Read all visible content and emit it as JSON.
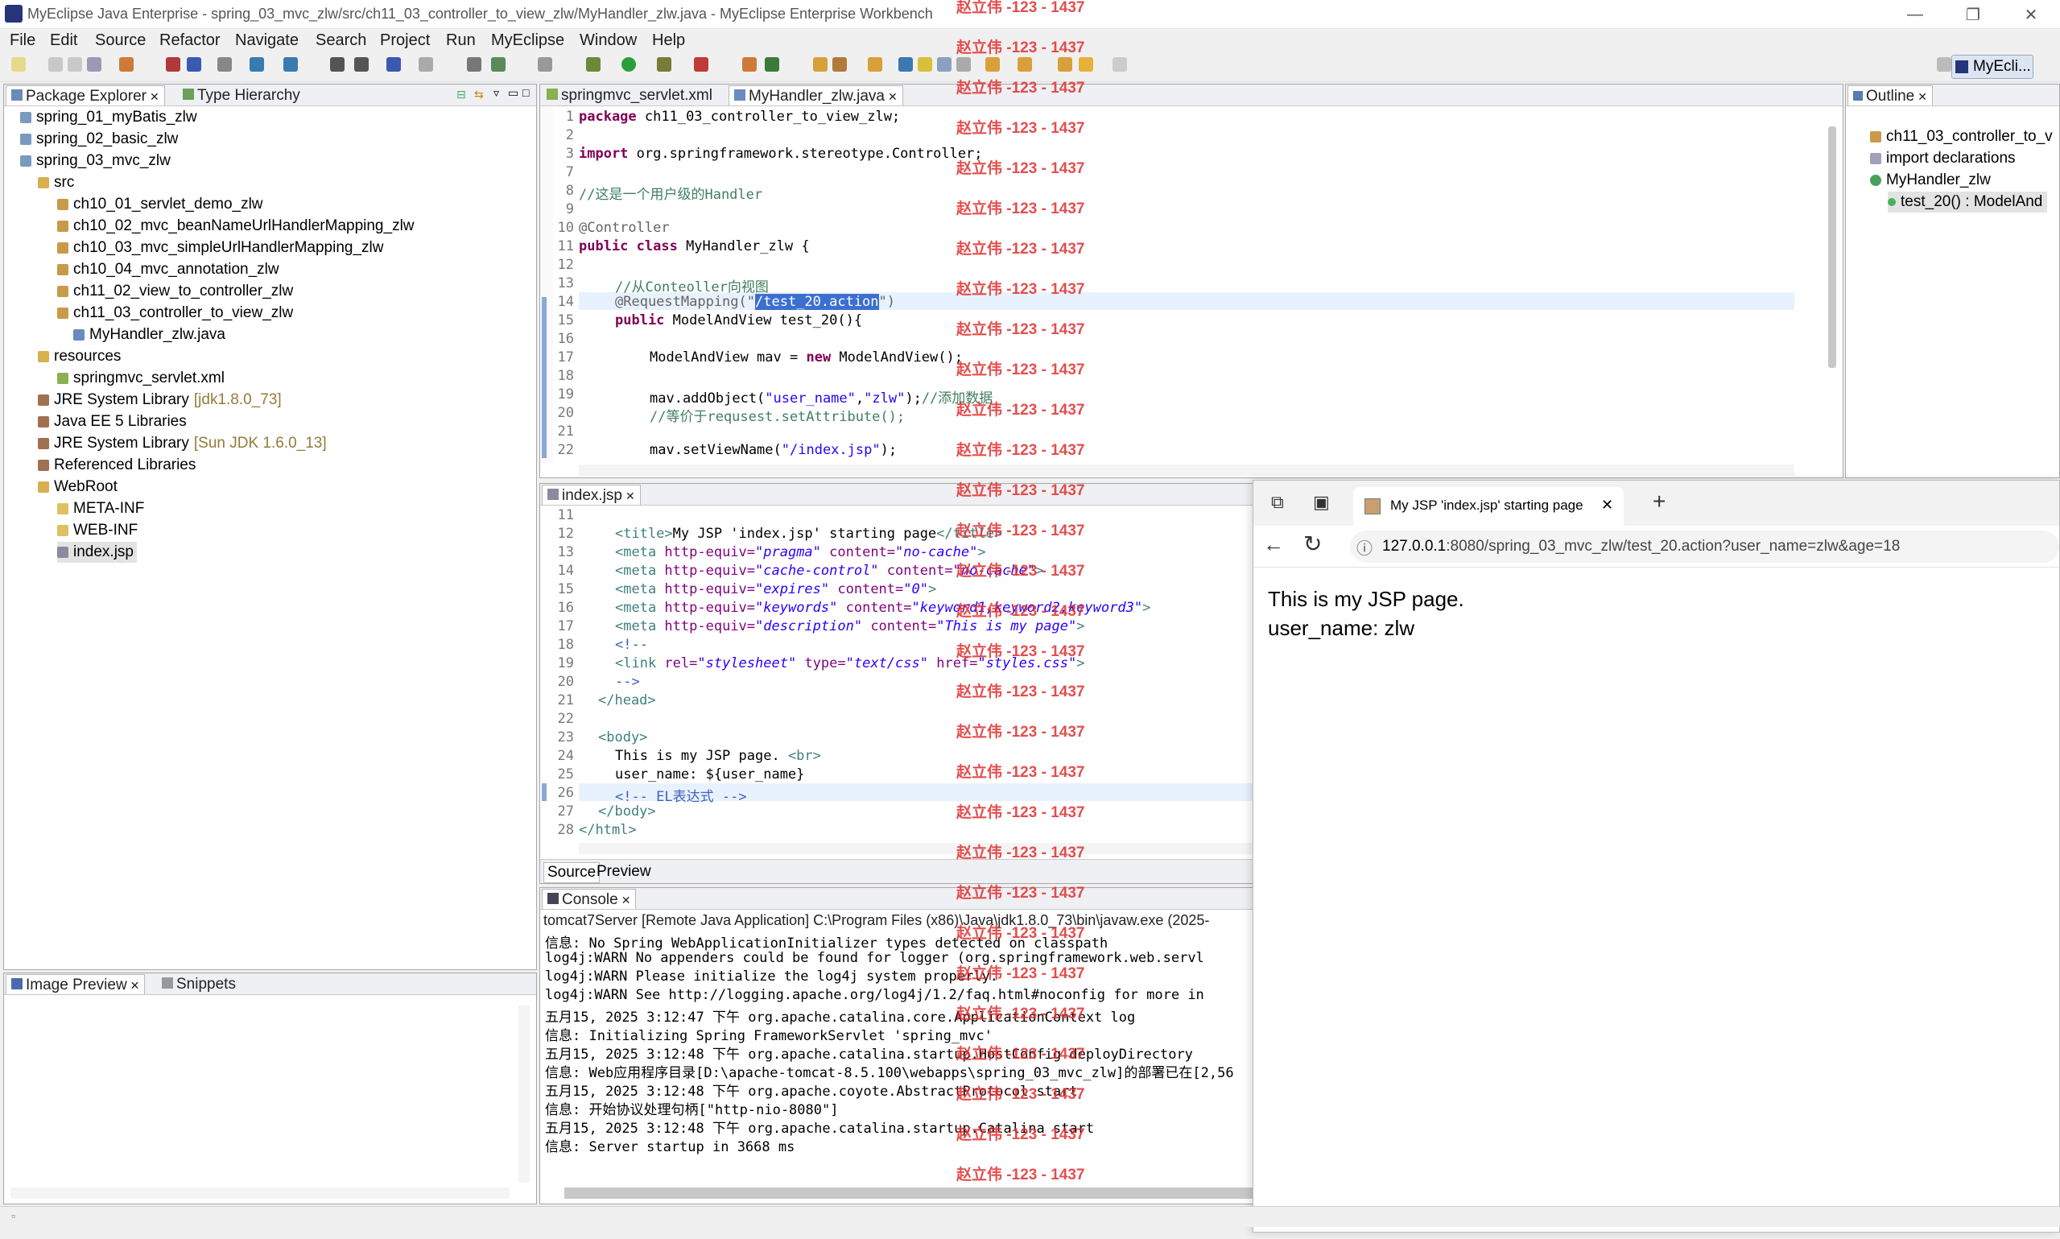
{
  "window": {
    "title": "MyEclipse Java Enterprise - spring_03_mvc_zlw/src/ch11_03_controller_to_view_zlw/MyHandler_zlw.java - MyEclipse Enterprise Workbench",
    "minimize": "—",
    "maximize": "❐",
    "close": "✕"
  },
  "menu": [
    "File",
    "Edit",
    "Source",
    "Refactor",
    "Navigate",
    "Search",
    "Project",
    "Run",
    "MyEclipse",
    "Window",
    "Help"
  ],
  "perspective": "MyEcli...",
  "explorer": {
    "tab1": "Package Explorer",
    "tab2": "Type Hierarchy",
    "items": [
      {
        "label": "spring_01_myBatis_zlw",
        "extra": ""
      },
      {
        "label": "spring_02_basic_zlw",
        "extra": ""
      },
      {
        "label": "spring_03_mvc_zlw",
        "extra": ""
      },
      {
        "label": "src",
        "extra": ""
      },
      {
        "label": "ch10_01_servlet_demo_zlw",
        "extra": ""
      },
      {
        "label": "ch10_02_mvc_beanNameUrlHandlerMapping_zlw",
        "extra": ""
      },
      {
        "label": "ch10_03_mvc_simpleUrlHandlerMapping_zlw",
        "extra": ""
      },
      {
        "label": "ch10_04_mvc_annotation_zlw",
        "extra": ""
      },
      {
        "label": "ch11_02_view_to_controller_zlw",
        "extra": ""
      },
      {
        "label": "ch11_03_controller_to_view_zlw",
        "extra": ""
      },
      {
        "label": "MyHandler_zlw.java",
        "extra": ""
      },
      {
        "label": "resources",
        "extra": ""
      },
      {
        "label": "springmvc_servlet.xml",
        "extra": ""
      },
      {
        "label": "JRE System Library",
        "extra": "[jdk1.8.0_73]"
      },
      {
        "label": "Java EE 5 Libraries",
        "extra": ""
      },
      {
        "label": "JRE System Library",
        "extra": "[Sun JDK 1.6.0_13]"
      },
      {
        "label": "Referenced Libraries",
        "extra": ""
      },
      {
        "label": "WebRoot",
        "extra": ""
      },
      {
        "label": "META-INF",
        "extra": ""
      },
      {
        "label": "WEB-INF",
        "extra": ""
      },
      {
        "label": "index.jsp",
        "extra": ""
      }
    ]
  },
  "image_preview": {
    "tab1": "Image Preview",
    "tab2": "Snippets"
  },
  "editor1": {
    "tab1": "springmvc_servlet.xml",
    "tab2": "MyHandler_zlw.java",
    "lines": [
      "1",
      "2",
      "3",
      "7",
      "8",
      "9",
      "10",
      "11",
      "12",
      "13",
      "14",
      "15",
      "16",
      "17",
      "18",
      "19",
      "20",
      "21",
      "22"
    ],
    "code": {
      "l1a": "package",
      "l1b": " ch11_03_controller_to_view_zlw;",
      "l3a": "import",
      "l3b": " org.springframework.stereotype.Controller;",
      "l8": "//这是一个用户级的Handler",
      "l10": "@Controller",
      "l11a": "public class",
      "l11b": " MyHandler_zlw {",
      "l13": "//从Conteoller向视图",
      "l14a": "@RequestMapping(\"",
      "l14b": "/test_20.action",
      "l14c": "\")",
      "l15a": "public",
      "l15b": " ModelAndView test_20(){",
      "l17a": "ModelAndView mav = ",
      "l17b": "new",
      "l17c": " ModelAndView();",
      "l19a": "mav.addObject(",
      "l19b": "\"user_name\"",
      "l19c": ",",
      "l19d": "\"zlw\"",
      "l19e": ");",
      "l19f": "//添加数据",
      "l20": "//等价于requsest.setAttribute();",
      "l22a": "mav.setViewName(",
      "l22b": "\"/index.jsp\"",
      "l22c": ");"
    }
  },
  "editor2": {
    "tab": "index.jsp",
    "lines": [
      "11",
      "12",
      "13",
      "14",
      "15",
      "16",
      "17",
      "18",
      "19",
      "20",
      "21",
      "22",
      "23",
      "24",
      "25",
      "26",
      "27",
      "28"
    ],
    "source_tab": "Source",
    "preview_tab": "Preview",
    "code": {
      "l12a": "<title>",
      "l12b": "My JSP 'index.jsp' starting page",
      "l12c": "</title>",
      "l13a": "<meta ",
      "l13b": "http-equiv=",
      "l13c": "\"pragma\"",
      "l13d": " content=",
      "l13e": "\"no-cache\"",
      "l13f": ">",
      "l14c": "\"cache-control\"",
      "l14e": "\"no-cache\"",
      "l15c": "\"expires\"",
      "l15e": "\"0\"",
      "l16c": "\"keywords\"",
      "l16e": "\"keyword1,keyword2,keyword3\"",
      "l17c": "\"description\"",
      "l17e": "\"This is my page\"",
      "l18": "<!--",
      "l19a": "<link ",
      "l19b": "rel=",
      "l19c": "\"stylesheet\"",
      "l19d": " type=",
      "l19e": "\"text/css\"",
      "l19f": " href=",
      "l19g": "\"styles.css\"",
      "l19h": ">",
      "l20": "-->",
      "l21": "</head>",
      "l23": "<body>",
      "l24a": "This is my JSP page. ",
      "l24b": "<br>",
      "l25": "user_name: ${user_name}",
      "l26": "<!-- EL表达式 -->",
      "l27": "</body>",
      "l28": "</html>"
    }
  },
  "outline": {
    "tab": "Outline",
    "items": [
      "ch11_03_controller_to_v",
      "import declarations",
      "MyHandler_zlw",
      "test_20() : ModelAnd"
    ]
  },
  "console": {
    "tab": "Console",
    "header": "tomcat7Server [Remote Java Application] C:\\Program Files (x86)\\Java\\jdk1.8.0_73\\bin\\javaw.exe (2025-",
    "lines": [
      "信息: No Spring WebApplicationInitializer types detected on classpath",
      "log4j:WARN No appenders could be found for logger (org.springframework.web.servl",
      "log4j:WARN Please initialize the log4j system properly.",
      "log4j:WARN See http://logging.apache.org/log4j/1.2/faq.html#noconfig for more in",
      "五月15, 2025 3:12:47 下午 org.apache.catalina.core.ApplicationContext log",
      "信息: Initializing Spring FrameworkServlet 'spring_mvc'",
      "五月15, 2025 3:12:48 下午 org.apache.catalina.startup.HostConfig deployDirectory",
      "信息: Web应用程序目录[D:\\apache-tomcat-8.5.100\\webapps\\spring_03_mvc_zlw]的部署已在[2,56",
      "五月15, 2025 3:12:48 下午 org.apache.coyote.AbstractProtocol start",
      "信息: 开始协议处理句柄[\"http-nio-8080\"]",
      "五月15, 2025 3:12:48 下午 org.apache.catalina.startup.Catalina start",
      "信息: Server startup in 3668 ms"
    ]
  },
  "browser": {
    "tab_title": "My JSP 'index.jsp' starting page",
    "url_host": "127.0.0.1",
    "url_rest": ":8080/spring_03_mvc_zlw/test_20.action?user_name=zlw&age=18",
    "body_line1": "This is my JSP page.",
    "body_line2": "user_name: zlw",
    "close": "✕",
    "newtab": "+",
    "back": "←",
    "reload": "↻",
    "info": "ⓘ"
  },
  "watermark": "赵立伟 -123 - 1437"
}
